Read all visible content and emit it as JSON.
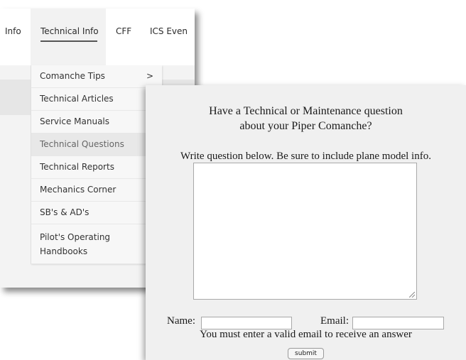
{
  "nav": {
    "items": [
      {
        "label": "Info"
      },
      {
        "label": "Technical Info"
      },
      {
        "label": "CFF"
      },
      {
        "label": "ICS Even"
      }
    ]
  },
  "dropdown": {
    "items": [
      {
        "label": "Comanche Tips",
        "has_submenu": true,
        "chevron": ">"
      },
      {
        "label": "Technical Articles"
      },
      {
        "label": "Service Manuals"
      },
      {
        "label": "Technical Questions",
        "active": true
      },
      {
        "label": "Technical Reports"
      },
      {
        "label": "Mechanics Corner"
      },
      {
        "label": "SB's & AD's"
      },
      {
        "label": "Pilot's Operating Handbooks"
      }
    ]
  },
  "form": {
    "title_line1": "Have a Technical or Maintenance question",
    "title_line2": "about your Piper Comanche?",
    "instructions": "Write question below. Be sure to include plane model info.",
    "question_value": "",
    "name_label": "Name:",
    "name_value": "",
    "email_label": "Email:",
    "email_value": "",
    "note": "You must enter a valid email to receive an answer",
    "submit_label": "submit"
  }
}
